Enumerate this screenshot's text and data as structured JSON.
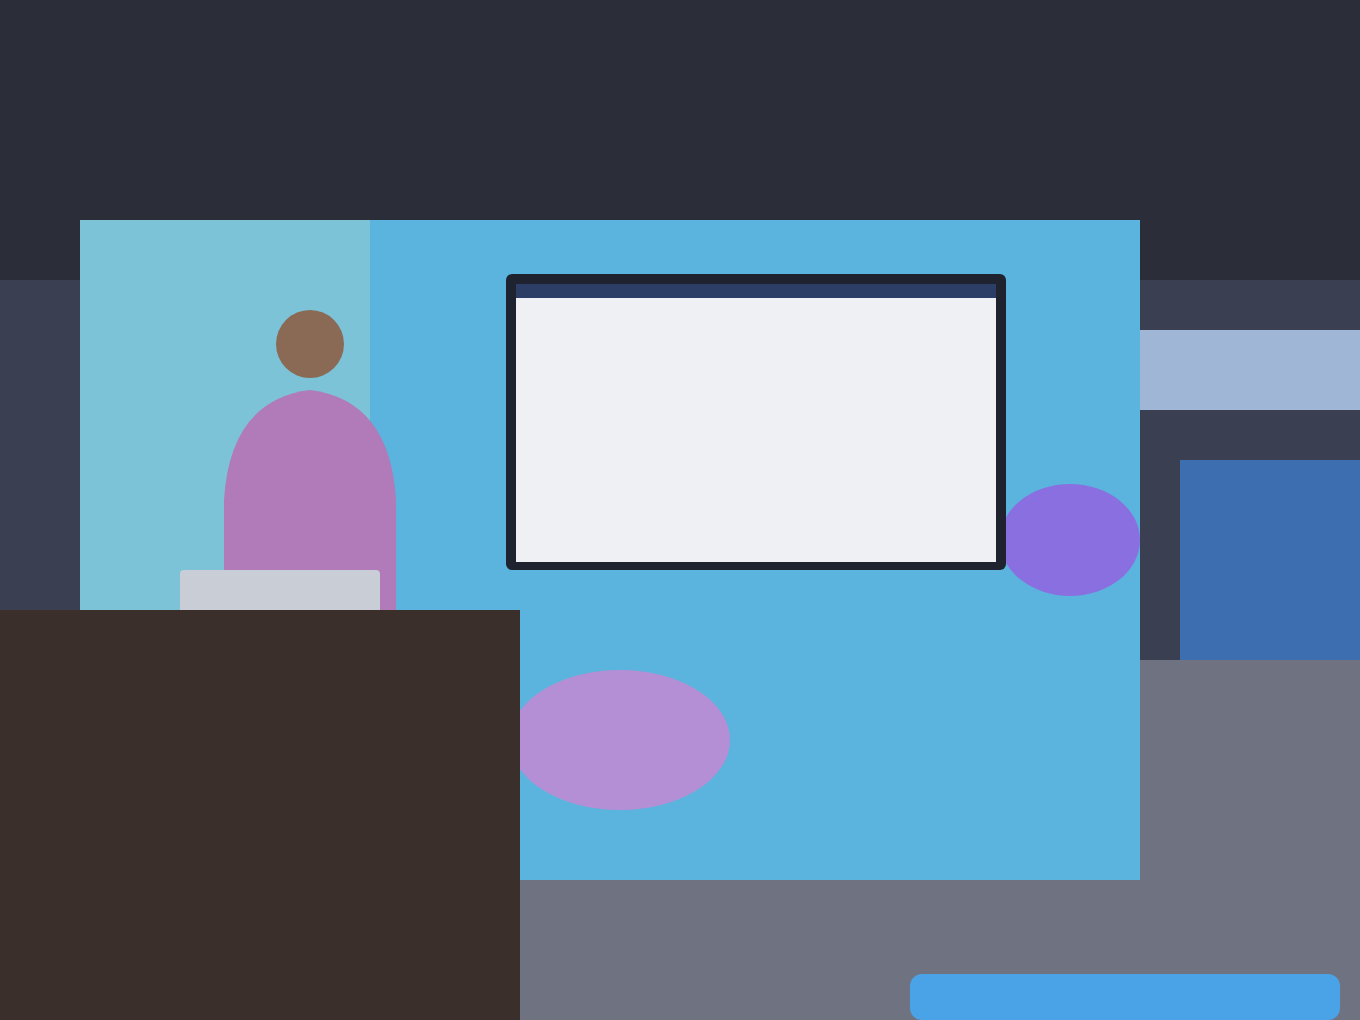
{
  "photo": {
    "kind": "stage"
  }
}
